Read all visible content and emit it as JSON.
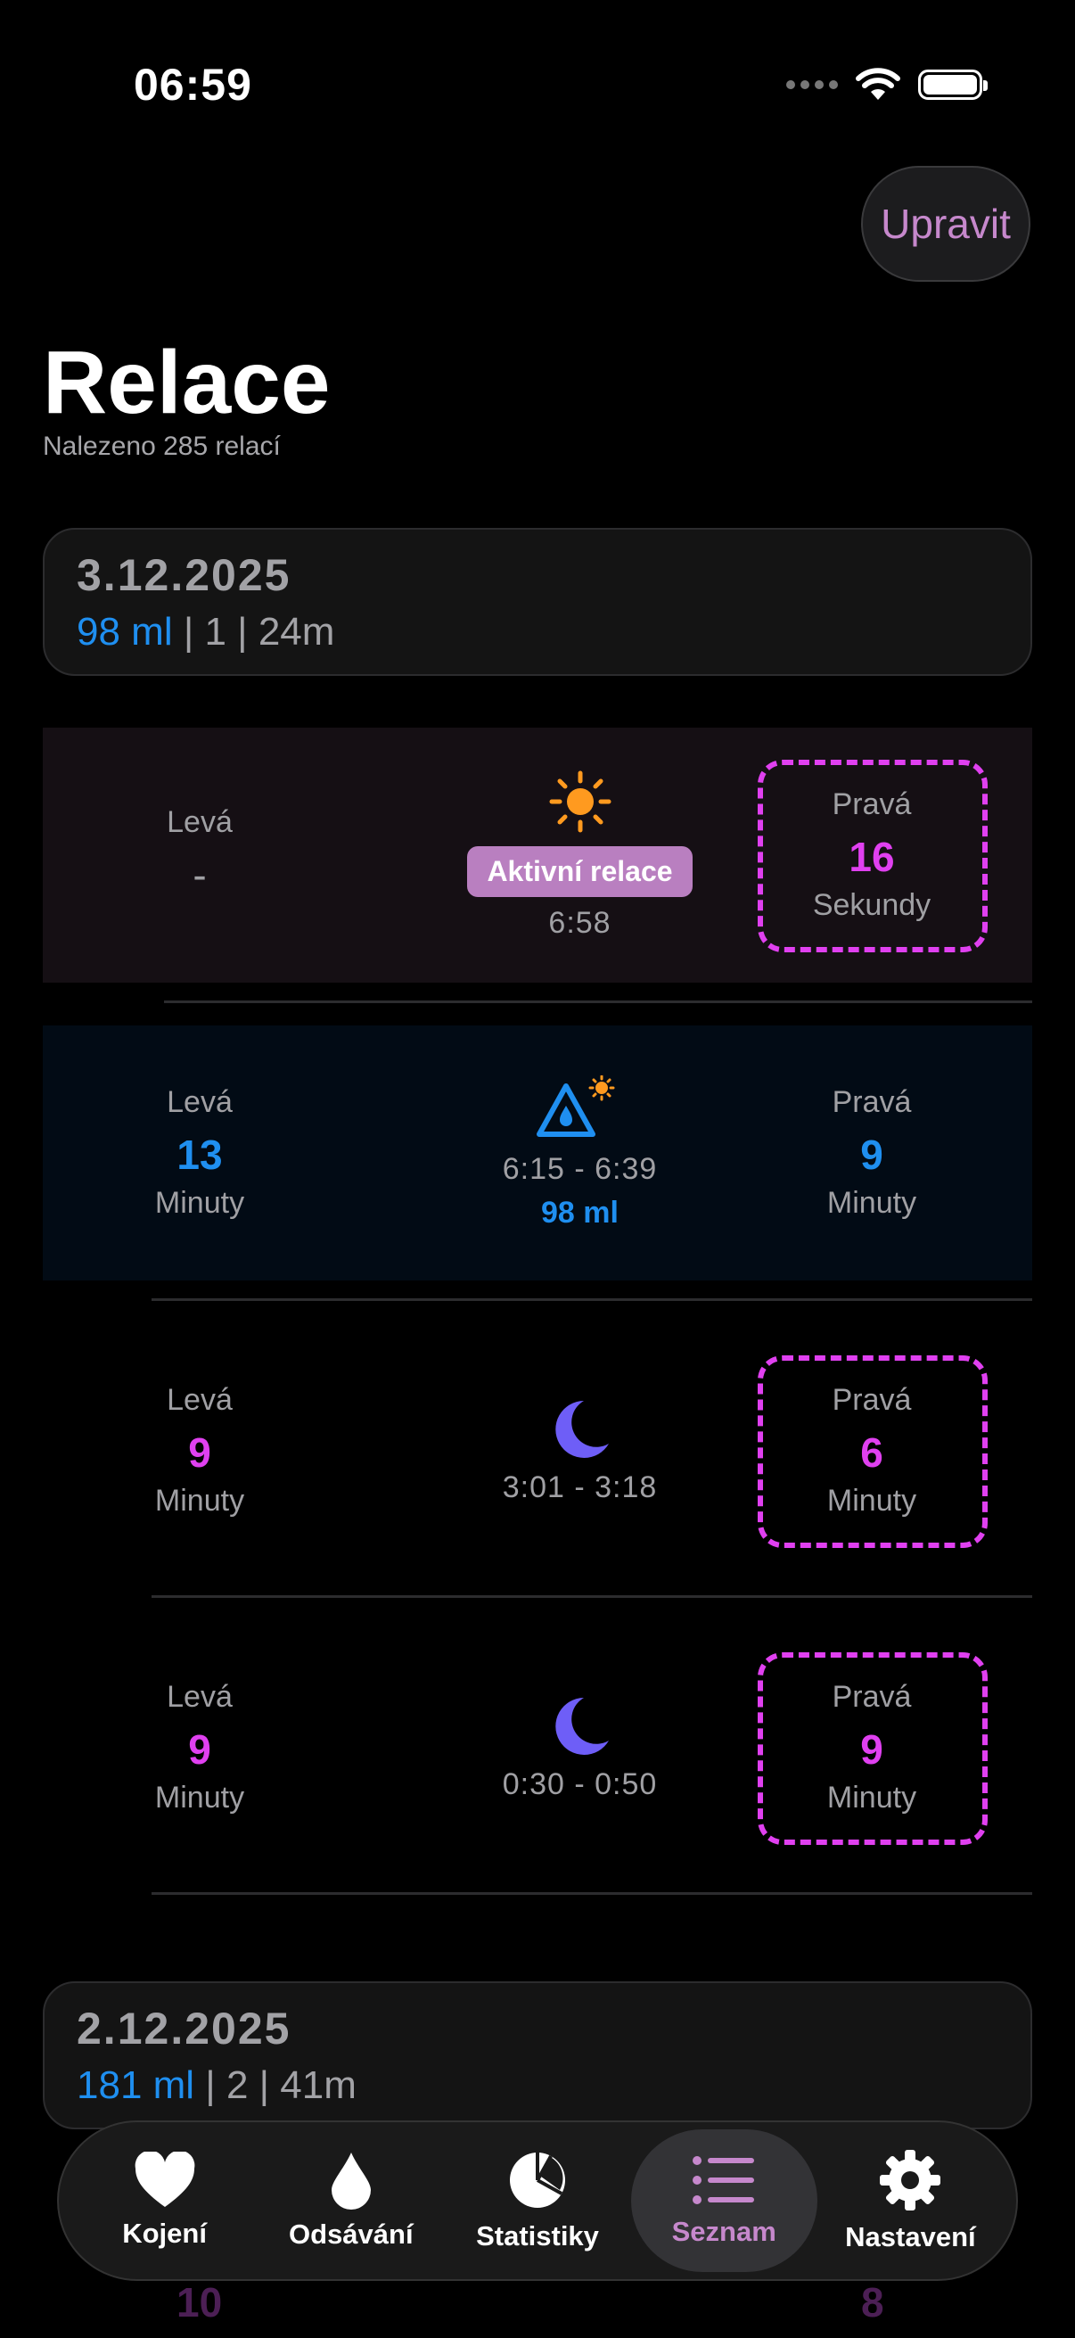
{
  "status": {
    "time": "06:59"
  },
  "header": {
    "edit_label": "Upravit",
    "title": "Relace",
    "subtitle": "Nalezeno 285 relací"
  },
  "days": [
    {
      "date": "3.12.2025",
      "ml": "98 ml",
      "rest": " | 1 | 24m"
    },
    {
      "date": "2.12.2025",
      "ml": "181 ml",
      "rest": " | 2 | 41m"
    }
  ],
  "sessions": [
    {
      "left_label": "Levá",
      "left_value": "-",
      "icon": "sun-icon",
      "badge": "Aktivní relace",
      "time": "6:58",
      "right_label": "Pravá",
      "right_value": "16",
      "right_unit": "Sekundy"
    },
    {
      "left_label": "Levá",
      "left_value": "13",
      "left_unit": "Minuty",
      "icon": "pump-day-icon",
      "time": "6:15 - 6:39",
      "ml": "98 ml",
      "right_label": "Pravá",
      "right_value": "9",
      "right_unit": "Minuty"
    },
    {
      "left_label": "Levá",
      "left_value": "9",
      "left_unit": "Minuty",
      "icon": "moon-icon",
      "time": "3:01 - 3:18",
      "right_label": "Pravá",
      "right_value": "6",
      "right_unit": "Minuty"
    },
    {
      "left_label": "Levá",
      "left_value": "9",
      "left_unit": "Minuty",
      "icon": "moon-icon",
      "time": "0:30 - 0:50",
      "right_label": "Pravá",
      "right_value": "9",
      "right_unit": "Minuty"
    }
  ],
  "peek": {
    "left_value": "10",
    "right_value": "8"
  },
  "tabs": [
    {
      "label": "Kojení",
      "icon": "heart-icon"
    },
    {
      "label": "Odsávání",
      "icon": "drop-icon"
    },
    {
      "label": "Statistiky",
      "icon": "pie-chart-icon"
    },
    {
      "label": "Seznam",
      "icon": "list-icon",
      "selected": true
    },
    {
      "label": "Nastavení",
      "icon": "gear-icon"
    }
  ],
  "colors": {
    "accent": "#c688cc",
    "pink": "#e040f0",
    "blue": "#1f8ff0",
    "moon": "#6e5ef7",
    "sun": "#ff9a1f"
  }
}
